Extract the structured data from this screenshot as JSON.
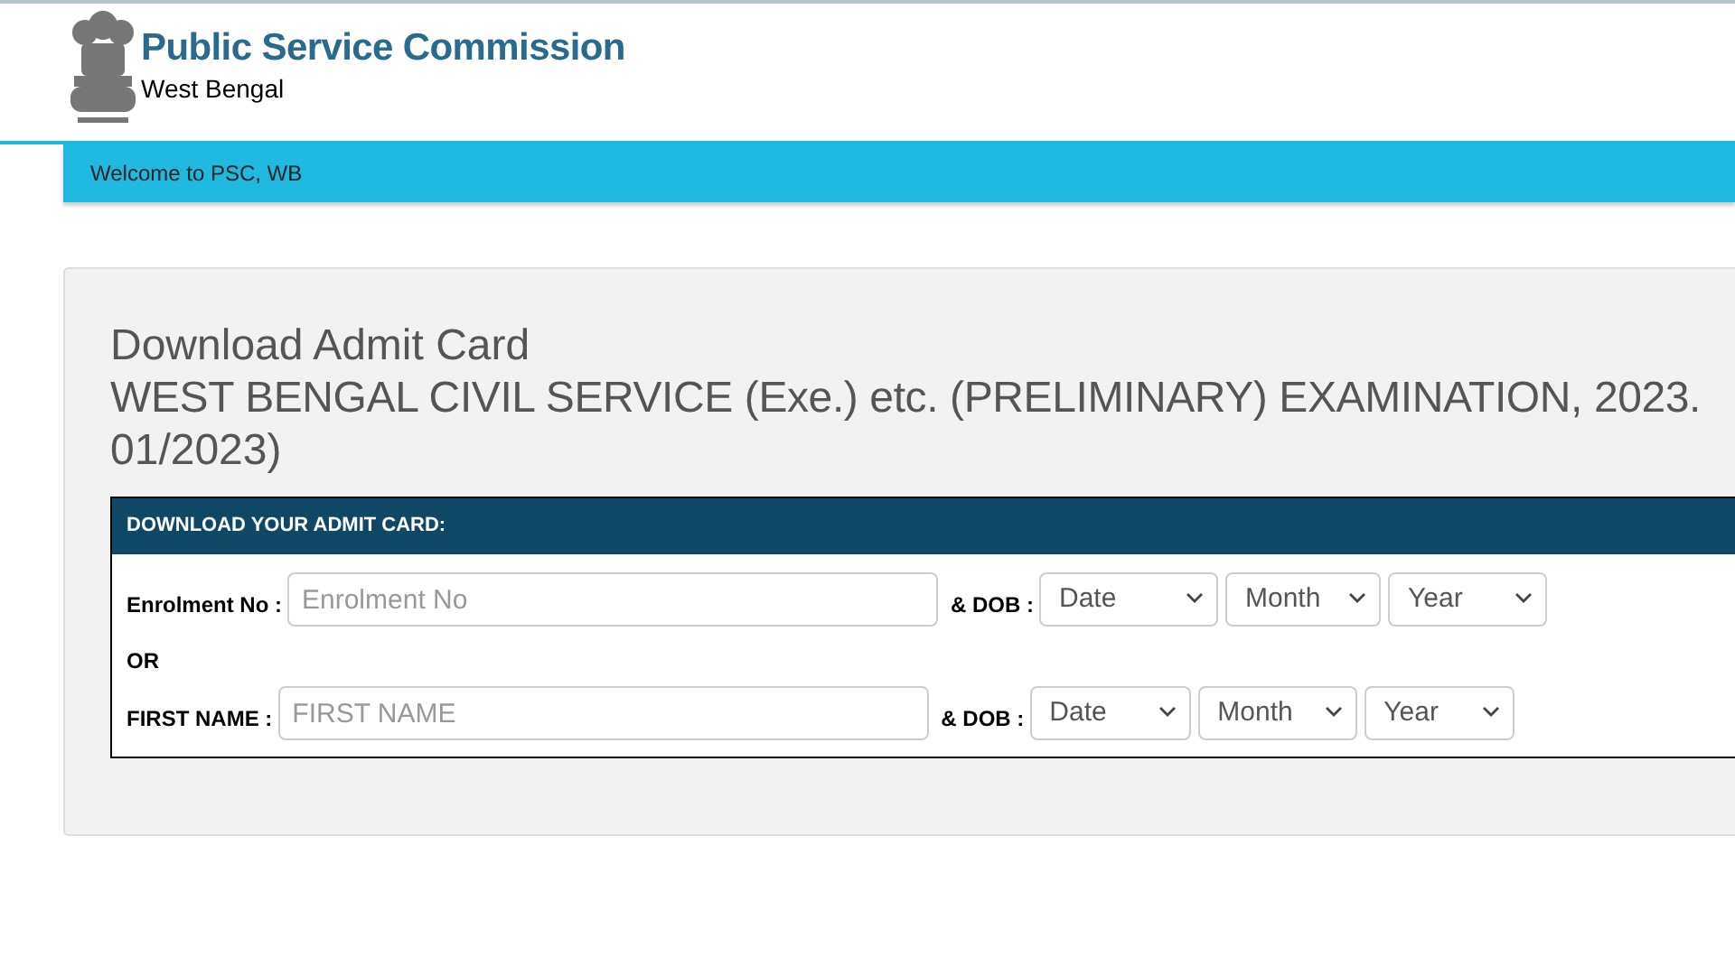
{
  "header": {
    "title": "Public Service Commission",
    "subtitle": "West Bengal"
  },
  "nav": {
    "text": "Welcome to PSC, WB"
  },
  "panel": {
    "heading": "Download Admit Card",
    "exam_line_1": "WEST BENGAL CIVIL SERVICE (Exe.) etc. (PRELIMINARY) EXAMINATION, 2023.",
    "exam_line_2": "01/2023)"
  },
  "form": {
    "title": "DOWNLOAD YOUR ADMIT CARD:",
    "rows": [
      {
        "label": "Enrolment No :",
        "placeholder": "Enrolment No",
        "dob_label": "& DOB :",
        "selects": [
          "Date",
          "Month",
          "Year"
        ]
      },
      {
        "label": "FIRST NAME :",
        "placeholder": "FIRST NAME",
        "dob_label": "& DOB :",
        "selects": [
          "Date",
          "Month",
          "Year"
        ]
      }
    ],
    "separator": "OR"
  }
}
